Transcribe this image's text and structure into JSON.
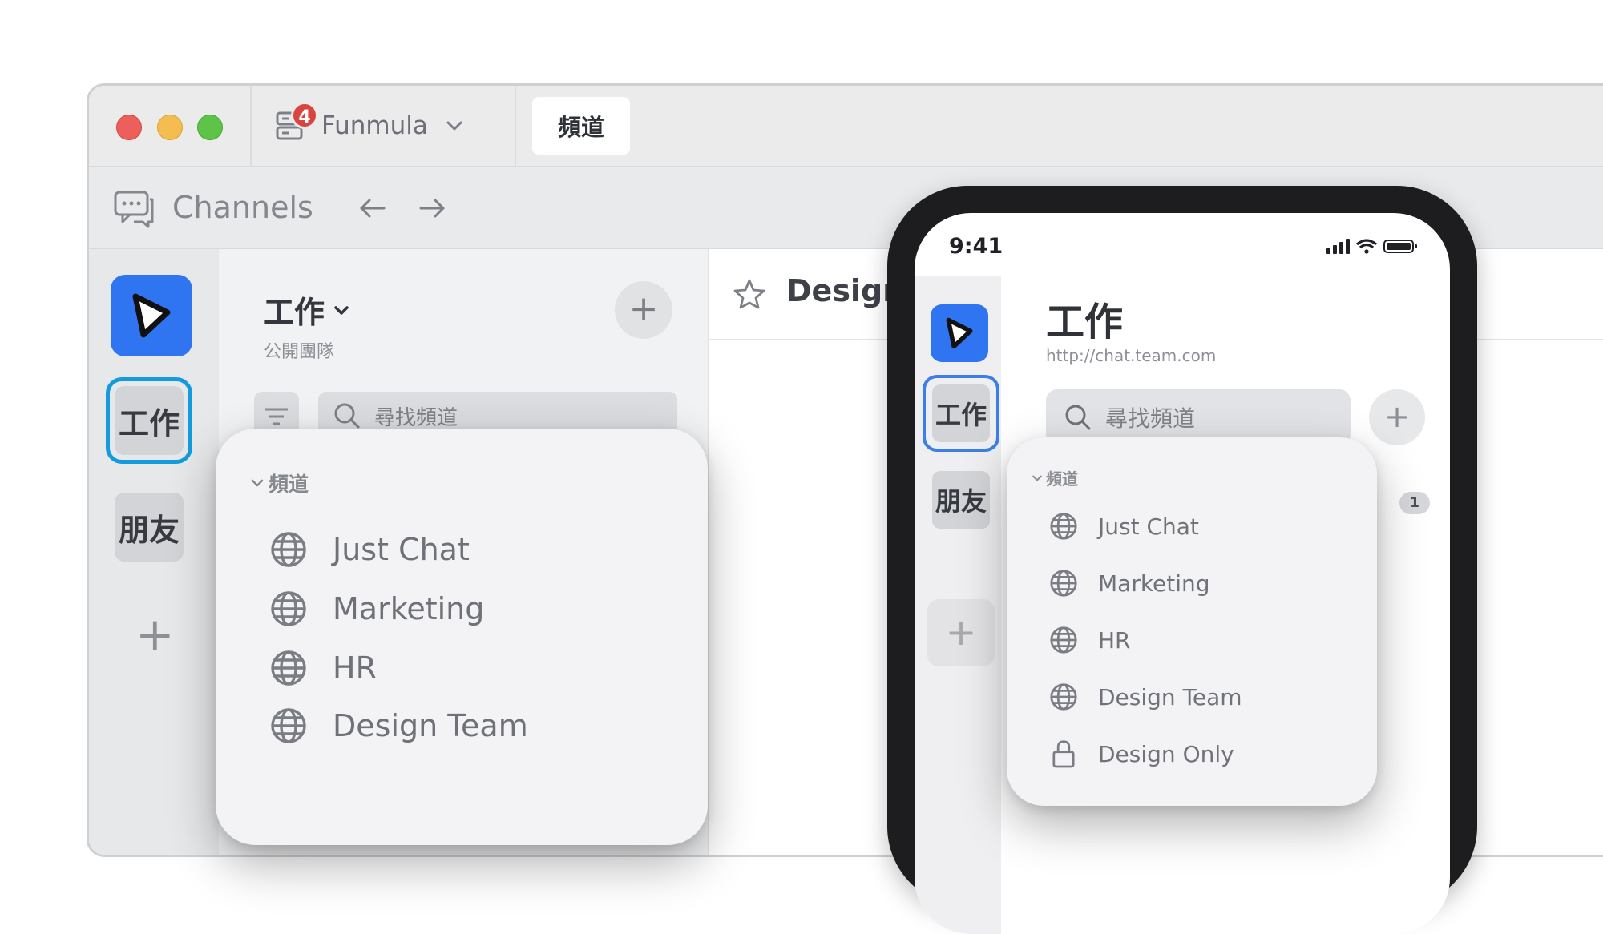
{
  "window": {
    "server": {
      "name": "Funmula",
      "badge": "4"
    },
    "tab_label": "頻道",
    "toolbar_title": "Channels"
  },
  "sidebar": {
    "teams": [
      "工作",
      "朋友"
    ],
    "selected_team": "工作"
  },
  "channel_pane": {
    "workspace_title": "工作",
    "workspace_subtitle": "公開團隊",
    "search_placeholder": "尋找頻道",
    "add_label": "+"
  },
  "main": {
    "channel_title": "Design"
  },
  "desktop_popup": {
    "section": "頻道",
    "channels": [
      {
        "name": "Just Chat",
        "icon": "globe-icon"
      },
      {
        "name": "Marketing",
        "icon": "globe-icon"
      },
      {
        "name": "HR",
        "icon": "globe-icon"
      },
      {
        "name": "Design Team",
        "icon": "globe-icon"
      }
    ]
  },
  "phone": {
    "time": "9:41",
    "teams": [
      "工作",
      "朋友"
    ],
    "workspace_title": "工作",
    "workspace_url": "http://chat.team.com",
    "search_placeholder": "尋找頻道",
    "unread_count": "1",
    "popup": {
      "section": "頻道",
      "channels": [
        {
          "name": "Just Chat",
          "icon": "globe-icon"
        },
        {
          "name": "Marketing",
          "icon": "globe-icon"
        },
        {
          "name": "HR",
          "icon": "globe-icon"
        },
        {
          "name": "Design Team",
          "icon": "globe-icon"
        },
        {
          "name": "Design Only",
          "icon": "lock-icon"
        }
      ]
    }
  },
  "colors": {
    "brand_blue": "#2f74f0",
    "selection_ring": "#149bdf",
    "badge_red": "#d9453e"
  }
}
